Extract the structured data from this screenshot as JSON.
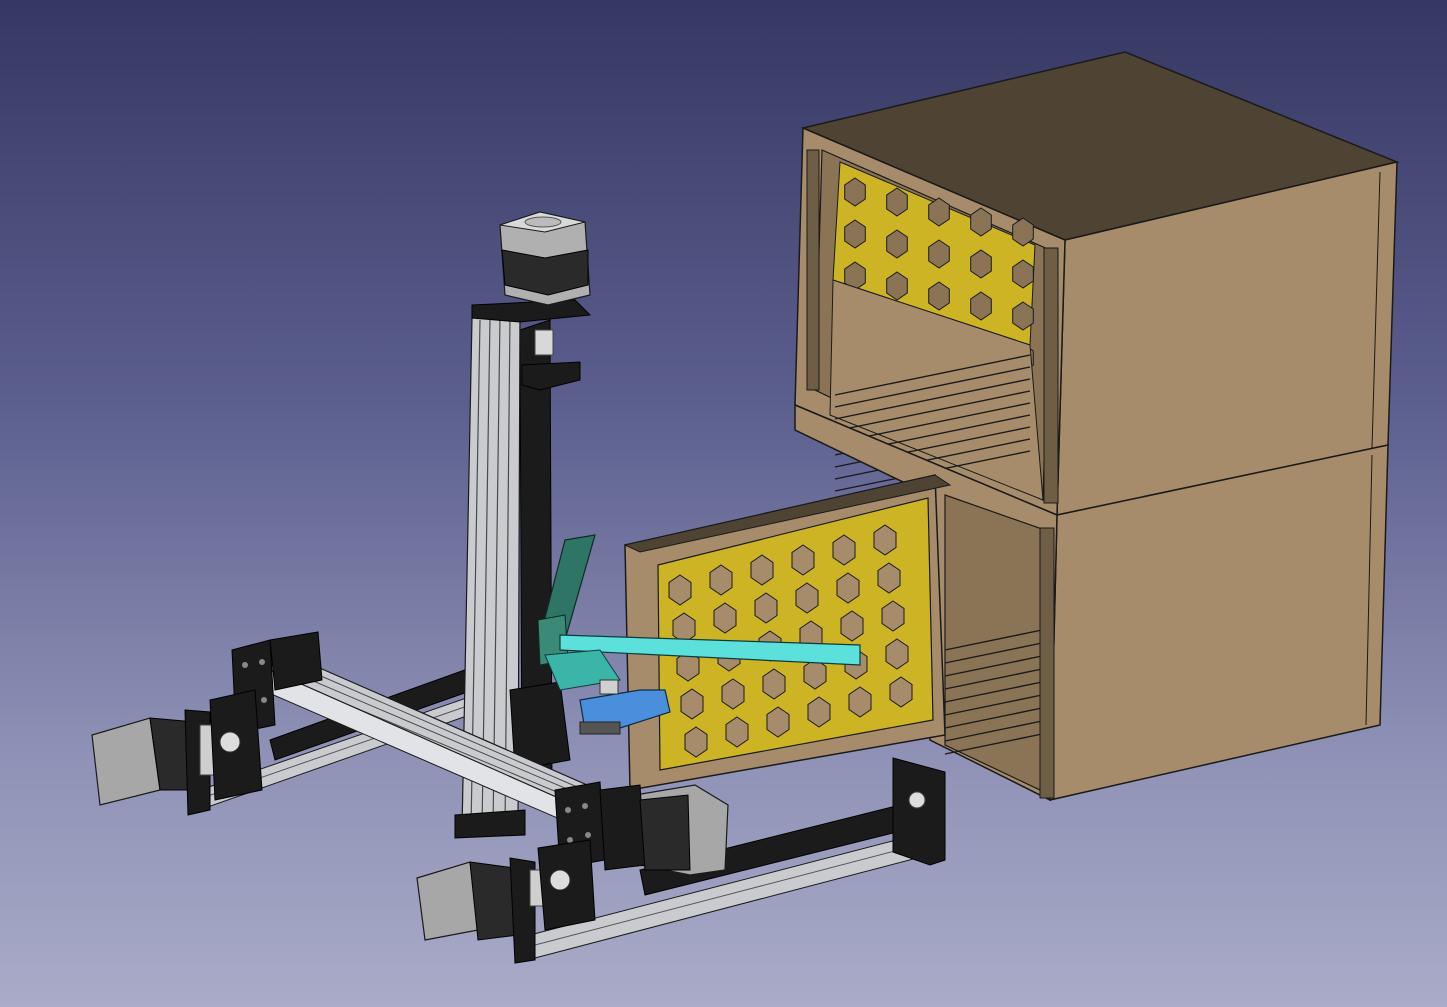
{
  "view": {
    "background_top": "#363863",
    "background_bottom": "#a9abc8"
  },
  "colors": {
    "shelf_wood": "#a68c6a",
    "shelf_wood_dark": "#4f4433",
    "shelf_wood_mid": "#8a7455",
    "panel_yellow": "#cdb424",
    "extrusion": "#c9cbcf",
    "frame_black": "#1b1b1b",
    "motor_gray": "#a7a7a7",
    "gripper_teal": "#2f7565",
    "arm_cyan": "#5be0dc",
    "gripper_blue": "#4a8fdc"
  },
  "objects": [
    {
      "name": "shelf-unit-upper"
    },
    {
      "name": "shelf-unit-lower"
    },
    {
      "name": "tray-hex-panel"
    },
    {
      "name": "vertical-z-axis"
    },
    {
      "name": "gantry-x-beam"
    },
    {
      "name": "rail-left"
    },
    {
      "name": "rail-front"
    },
    {
      "name": "stepper-motor-top"
    },
    {
      "name": "stepper-motor-left"
    },
    {
      "name": "stepper-motor-center"
    },
    {
      "name": "stepper-motor-front"
    },
    {
      "name": "gripper-assembly"
    }
  ]
}
